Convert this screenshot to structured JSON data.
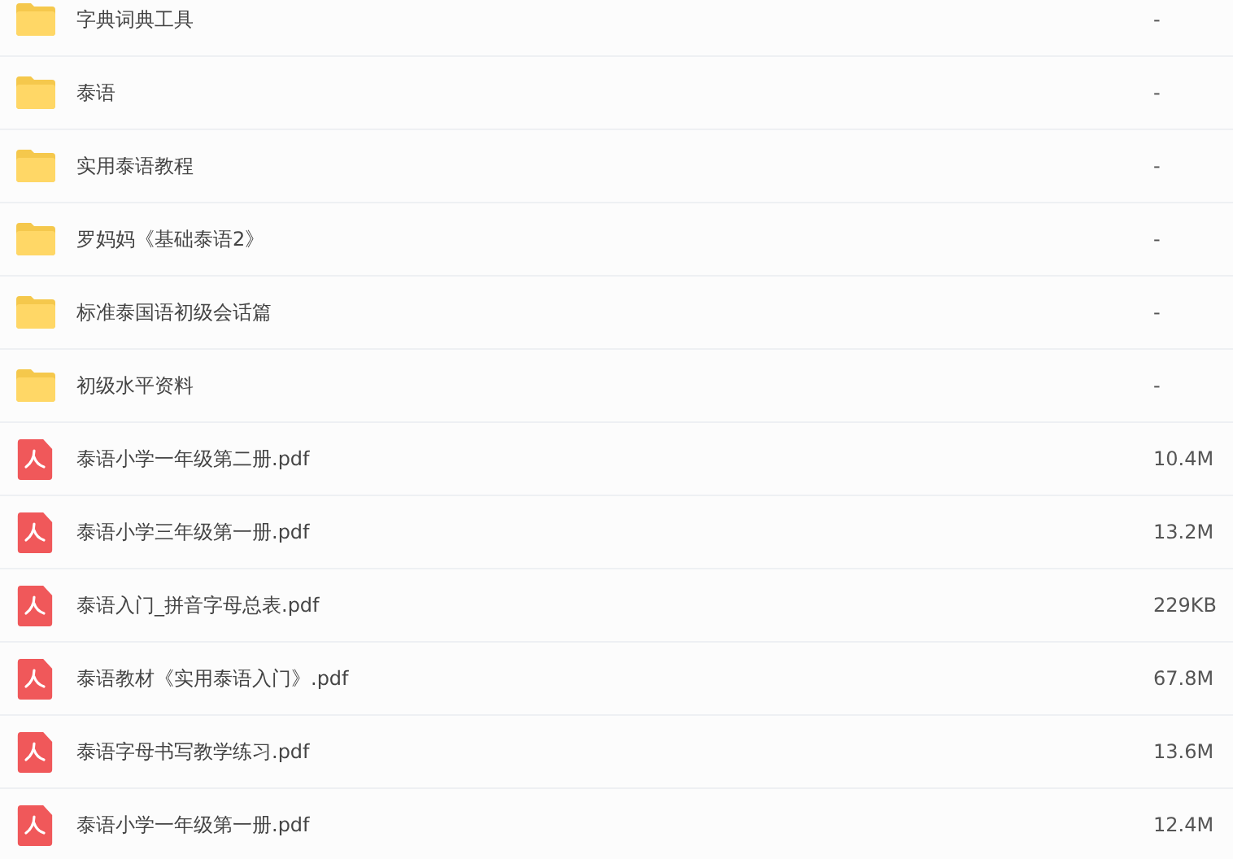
{
  "files": [
    {
      "kind": "folder",
      "name": "字典词典工具",
      "size": "-"
    },
    {
      "kind": "folder",
      "name": "泰语",
      "size": "-"
    },
    {
      "kind": "folder",
      "name": "实用泰语教程",
      "size": "-"
    },
    {
      "kind": "folder",
      "name": "罗妈妈《基础泰语2》",
      "size": "-"
    },
    {
      "kind": "folder",
      "name": "标准泰国语初级会话篇",
      "size": "-"
    },
    {
      "kind": "folder",
      "name": "初级水平资料",
      "size": "-"
    },
    {
      "kind": "pdf",
      "name": "泰语小学一年级第二册.pdf",
      "size": "10.4M"
    },
    {
      "kind": "pdf",
      "name": "泰语小学三年级第一册.pdf",
      "size": "13.2M"
    },
    {
      "kind": "pdf",
      "name": "泰语入门_拼音字母总表.pdf",
      "size": "229KB"
    },
    {
      "kind": "pdf",
      "name": "泰语教材《实用泰语入门》.pdf",
      "size": "67.8M"
    },
    {
      "kind": "pdf",
      "name": "泰语字母书写教学练习.pdf",
      "size": "13.6M"
    },
    {
      "kind": "pdf",
      "name": "泰语小学一年级第一册.pdf",
      "size": "12.4M"
    }
  ]
}
